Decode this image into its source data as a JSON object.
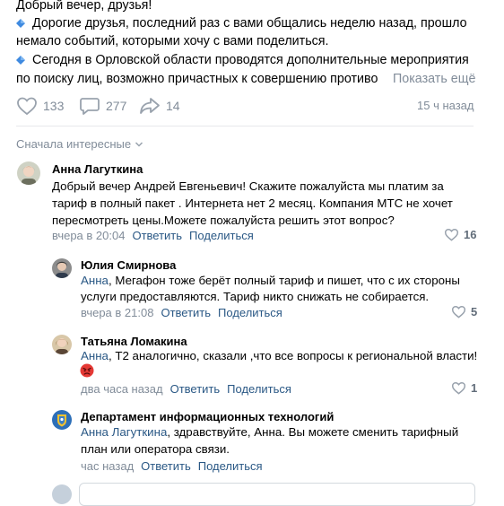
{
  "post": {
    "lines": [
      "Добрый вечер, друзья!",
      "Дорогие друзья, последний раз с вами общались неделю назад, прошло",
      "немало событий, которыми хочу с вами поделиться.",
      "Сегодня в Орловской области проводятся дополнительные мероприятия",
      "по поиску лиц, возможно причастных к совершению противо"
    ],
    "show_more": "Показать ещё",
    "likes": "133",
    "comments": "277",
    "shares": "14",
    "time": "15 ч назад",
    "bullet_color": "#4a90d9"
  },
  "sort_label": "Сначала интересные",
  "comments": [
    {
      "name": "Анна Лагуткина",
      "lines": [
        "Добрый вечер Андрей Евгеньевич! Скажите пожалуйста мы платим за",
        "тариф в полный пакет . Интернета нет 2 месяц. Компания МТС не хочет",
        "пересмотреть цены.Можете пожалуйста решить этот вопрос?"
      ],
      "time": "вчера в 20:04",
      "reply": "Ответить",
      "share": "Поделиться",
      "likes": "16"
    },
    {
      "name": "Юлия Смирнова",
      "mention": "Анна",
      "lines": [
        ", Мегафон тоже берёт полный тариф и пишет, что с их стороны",
        "услуги предоставляются. Тариф никто снижать не собирается."
      ],
      "time": "вчера в 21:08",
      "reply": "Ответить",
      "share": "Поделиться",
      "likes": "5"
    },
    {
      "name": "Татьяна Ломакина",
      "mention": "Анна",
      "lines": [
        ", Т2 аналогично, сказали ,что все вопросы к региональной власти!"
      ],
      "emoji": "angry-face-emoji",
      "time": "два часа назад",
      "reply": "Ответить",
      "share": "Поделиться",
      "likes": "1"
    },
    {
      "name": "Департамент информационных технологий",
      "mention": "Анна Лагуткина",
      "lines": [
        ", здравствуйте, Анна. Вы можете сменить тарифный",
        "план или оператора связи."
      ],
      "time": "час назад",
      "reply": "Ответить",
      "share": "Поделиться"
    }
  ],
  "colors": {
    "link": "#2a5885",
    "muted": "#818c99",
    "divider": "#e7e8ec"
  }
}
